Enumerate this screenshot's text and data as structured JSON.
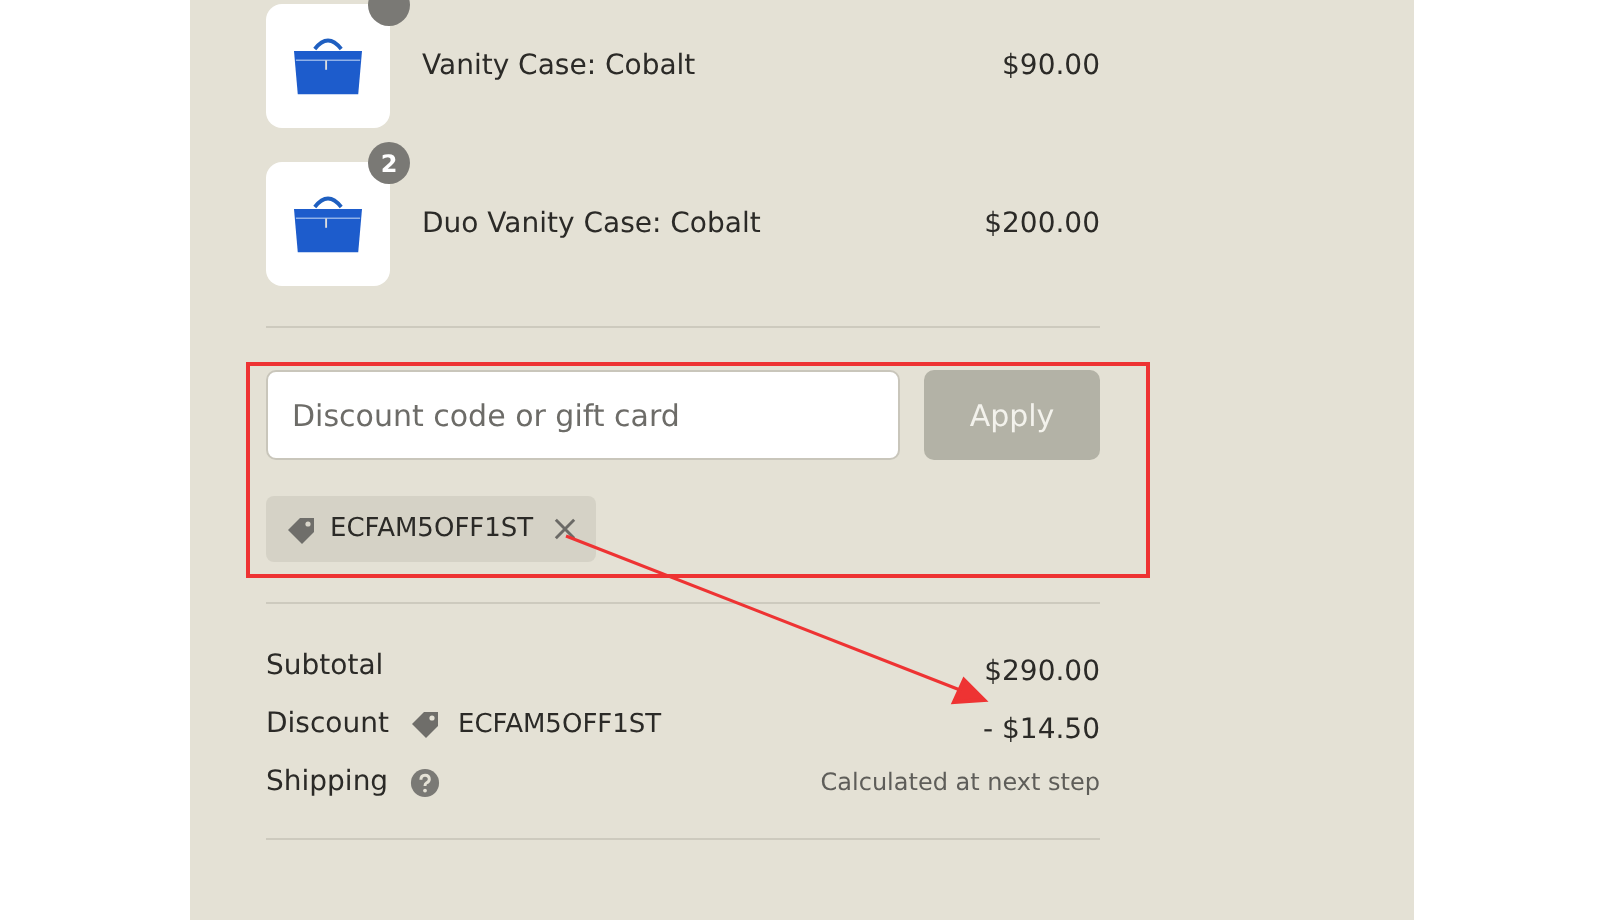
{
  "products": [
    {
      "name": "Vanity Case: Cobalt",
      "price": "$90.00"
    },
    {
      "quantity": "2",
      "name": "Duo Vanity Case: Cobalt",
      "price": "$200.00"
    }
  ],
  "discount_field": {
    "placeholder": "Discount code or gift card"
  },
  "apply_button": {
    "label": "Apply",
    "disabled": true
  },
  "applied_codes": [
    {
      "code": "ECFAM5OFF1ST"
    }
  ],
  "summary": [
    {
      "kind": "plain",
      "label": "Subtotal",
      "value": "$290.00"
    },
    {
      "kind": "discount",
      "label": "Discount",
      "code": "ECFAM5OFF1ST",
      "value": "- $14.50"
    },
    {
      "kind": "help",
      "label": "Shipping",
      "value": "Calculated at next step"
    }
  ]
}
